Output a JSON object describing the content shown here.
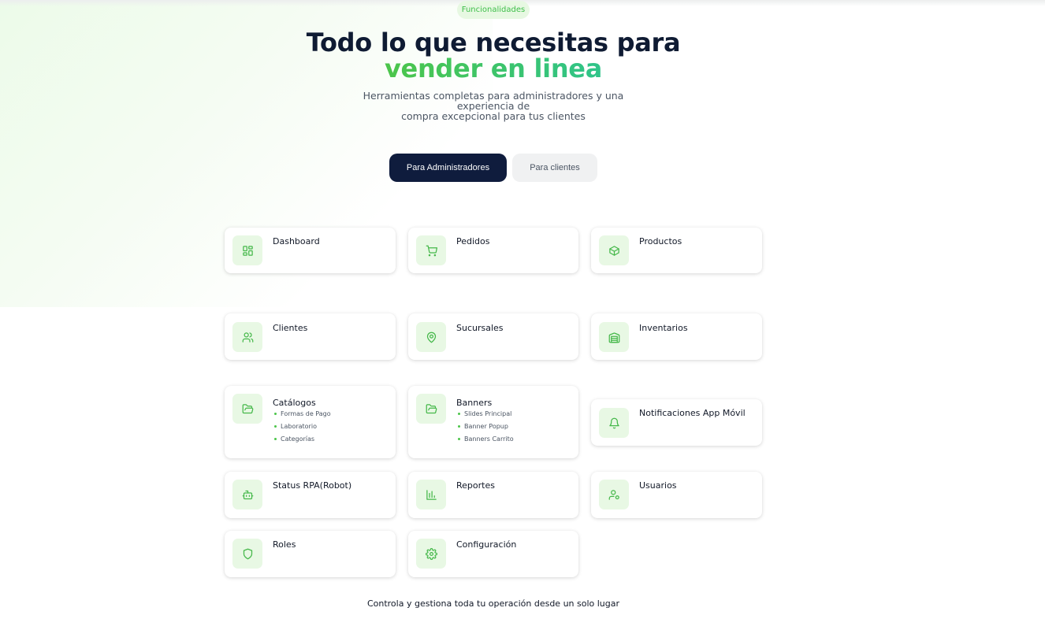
{
  "header": {
    "badge": "Funcionalidades",
    "title_line1": "Todo lo que necesitas para",
    "title_line2": "vender en linea",
    "subtitle_line1": "Herramientas completas para administradores y una experiencia de",
    "subtitle_line2": "compra excepcional para tus clientes"
  },
  "tabs": [
    {
      "label": "Para Administradores",
      "active": true
    },
    {
      "label": "Para clientes",
      "active": false
    }
  ],
  "features": [
    {
      "title": "Dashboard",
      "icon": "dashboard-icon"
    },
    {
      "title": "Pedidos",
      "icon": "cart-icon"
    },
    {
      "title": "Productos",
      "icon": "box-icon"
    },
    {
      "title": "Clientes",
      "icon": "users-icon"
    },
    {
      "title": "Sucursales",
      "icon": "map-pin-icon"
    },
    {
      "title": "Inventarios",
      "icon": "warehouse-icon"
    },
    {
      "title": "Catálogos",
      "icon": "folder-open-icon",
      "items": [
        "Formas de Pago",
        "Laboratorio",
        "Categorías"
      ]
    },
    {
      "title": "Banners",
      "icon": "folder-open-icon",
      "items": [
        "Slides Principal",
        "Banner Popup",
        "Banners Carrito"
      ]
    },
    {
      "title": "Notificaciones App Móvil",
      "icon": "bell-icon"
    },
    {
      "title": "Status RPA(Robot)",
      "icon": "bot-icon"
    },
    {
      "title": "Reportes",
      "icon": "chart-icon"
    },
    {
      "title": "Usuarios",
      "icon": "user-cog-icon"
    },
    {
      "title": "Roles",
      "icon": "shield-icon"
    },
    {
      "title": "Configuración",
      "icon": "gear-icon"
    }
  ],
  "footer": {
    "text": "Controla y gestiona toda tu operación desde un solo lugar"
  },
  "colors": {
    "accent": "#4cc54a",
    "navy": "#0f1c3d",
    "icon_bg": "#e8f8e4"
  }
}
